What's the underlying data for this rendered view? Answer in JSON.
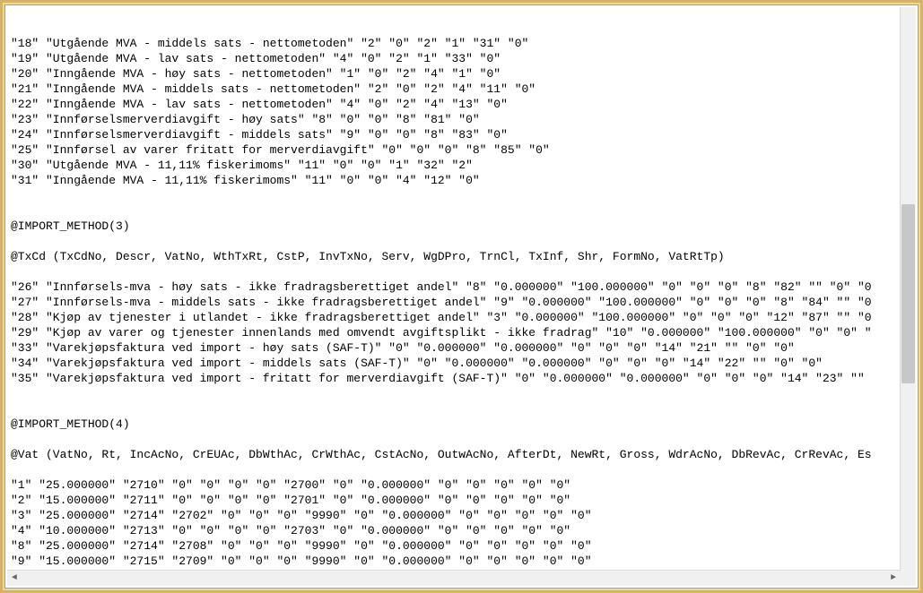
{
  "lines": [
    "\"18\" \"Utgående MVA - middels sats - nettometoden\" \"2\" \"0\" \"2\" \"1\" \"31\" \"0\"",
    "\"19\" \"Utgående MVA - lav sats - nettometoden\" \"4\" \"0\" \"2\" \"1\" \"33\" \"0\"",
    "\"20\" \"Inngående MVA - høy sats - nettometoden\" \"1\" \"0\" \"2\" \"4\" \"1\" \"0\"",
    "\"21\" \"Inngående MVA - middels sats - nettometoden\" \"2\" \"0\" \"2\" \"4\" \"11\" \"0\"",
    "\"22\" \"Inngående MVA - lav sats - nettometoden\" \"4\" \"0\" \"2\" \"4\" \"13\" \"0\"",
    "\"23\" \"Innførselsmerverdiavgift - høy sats\" \"8\" \"0\" \"0\" \"8\" \"81\" \"0\"",
    "\"24\" \"Innførselsmerverdiavgift - middels sats\" \"9\" \"0\" \"0\" \"8\" \"83\" \"0\"",
    "\"25\" \"Innførsel av varer fritatt for merverdiavgift\" \"0\" \"0\" \"0\" \"8\" \"85\" \"0\"",
    "\"30\" \"Utgående MVA - 11,11% fiskerimoms\" \"11\" \"0\" \"0\" \"1\" \"32\" \"2\"",
    "\"31\" \"Inngående MVA - 11,11% fiskerimoms\" \"11\" \"0\" \"0\" \"4\" \"12\" \"0\"",
    "",
    "",
    "@IMPORT_METHOD(3)",
    "",
    "@TxCd (TxCdNo, Descr, VatNo, WthTxRt, CstP, InvTxNo, Serv, WgDPro, TrnCl, TxInf, Shr, FormNo, VatRtTp)",
    "",
    "\"26\" \"Innførsels-mva - høy sats - ikke fradragsberettiget andel\" \"8\" \"0.000000\" \"100.000000\" \"0\" \"0\" \"0\" \"8\" \"82\" \"\" \"0\" \"0",
    "\"27\" \"Innførsels-mva - middels sats - ikke fradragsberettiget andel\" \"9\" \"0.000000\" \"100.000000\" \"0\" \"0\" \"0\" \"8\" \"84\" \"\" \"0",
    "\"28\" \"Kjøp av tjenester i utlandet - ikke fradragsberettiget andel\" \"3\" \"0.000000\" \"100.000000\" \"0\" \"0\" \"0\" \"12\" \"87\" \"\" \"0",
    "\"29\" \"Kjøp av varer og tjenester innenlands med omvendt avgiftsplikt - ikke fradrag\" \"10\" \"0.000000\" \"100.000000\" \"0\" \"0\" \"",
    "\"33\" \"Varekjøpsfaktura ved import - høy sats (SAF-T)\" \"0\" \"0.000000\" \"0.000000\" \"0\" \"0\" \"0\" \"14\" \"21\" \"\" \"0\" \"0\"",
    "\"34\" \"Varekjøpsfaktura ved import - middels sats (SAF-T)\" \"0\" \"0.000000\" \"0.000000\" \"0\" \"0\" \"0\" \"14\" \"22\" \"\" \"0\" \"0\"",
    "\"35\" \"Varekjøpsfaktura ved import - fritatt for merverdiavgift (SAF-T)\" \"0\" \"0.000000\" \"0.000000\" \"0\" \"0\" \"0\" \"14\" \"23\" \"\"",
    "",
    "",
    "@IMPORT_METHOD(4)",
    "",
    "@Vat (VatNo, Rt, IncAcNo, CrEUAc, DbWthAc, CrWthAc, CstAcNo, OutwAcNo, AfterDt, NewRt, Gross, WdrAcNo, DbRevAc, CrRevAc, Es",
    "",
    "\"1\" \"25.000000\" \"2710\" \"0\" \"0\" \"0\" \"0\" \"2700\" \"0\" \"0.000000\" \"0\" \"0\" \"0\" \"0\" \"0\"",
    "\"2\" \"15.000000\" \"2711\" \"0\" \"0\" \"0\" \"0\" \"2701\" \"0\" \"0.000000\" \"0\" \"0\" \"0\" \"0\" \"0\"",
    "\"3\" \"25.000000\" \"2714\" \"2702\" \"0\" \"0\" \"0\" \"9990\" \"0\" \"0.000000\" \"0\" \"0\" \"0\" \"0\" \"0\"",
    "\"4\" \"10.000000\" \"2713\" \"0\" \"0\" \"0\" \"0\" \"2703\" \"0\" \"0.000000\" \"0\" \"0\" \"0\" \"0\" \"0\"",
    "\"8\" \"25.000000\" \"2714\" \"2708\" \"0\" \"0\" \"0\" \"9990\" \"0\" \"0.000000\" \"0\" \"0\" \"0\" \"0\" \"0\"",
    "\"9\" \"15.000000\" \"2715\" \"2709\" \"0\" \"0\" \"0\" \"9990\" \"0\" \"0.000000\" \"0\" \"0\" \"0\" \"0\" \"0\""
  ],
  "scroll": {
    "left_arrow": "◄",
    "right_arrow": "►"
  }
}
